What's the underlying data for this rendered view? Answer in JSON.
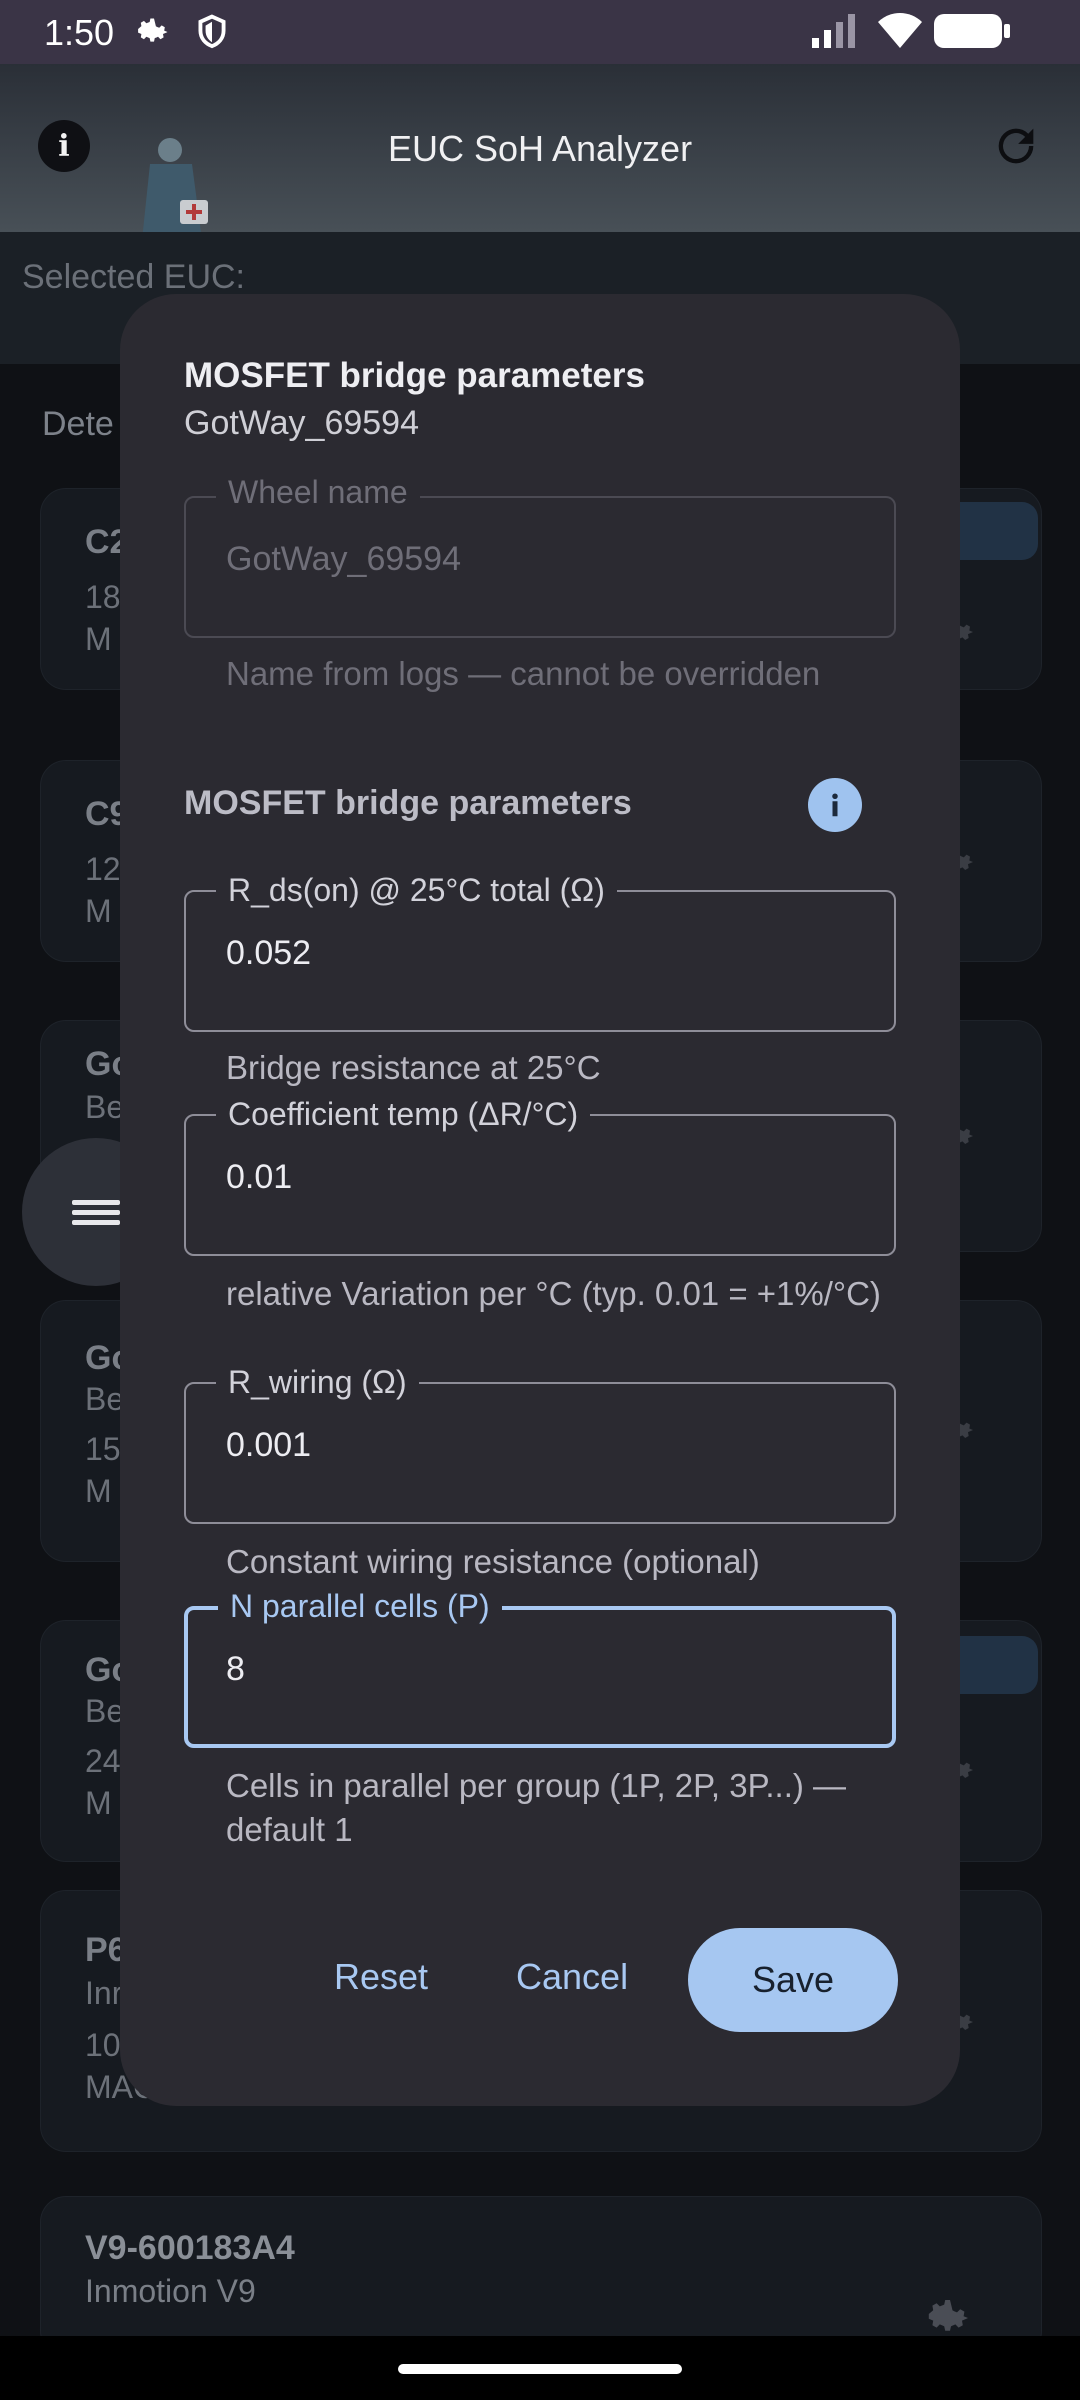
{
  "status_bar": {
    "time": "1:50"
  },
  "app_bar": {
    "title": "EUC SoH Analyzer"
  },
  "background": {
    "selected_label": "Selected EUC:",
    "detected_label": "Dete",
    "cards": [
      {
        "line1": "C2",
        "line2": "18",
        "line3": "M",
        "badge": true
      },
      {
        "line1": "C9",
        "line2": "12",
        "line3": "M",
        "badge": false
      },
      {
        "line1": "Go",
        "line2": "Be",
        "line3": "",
        "badge": false
      },
      {
        "line1": "Go",
        "line2": "Be",
        "line3": "15",
        "line4": "M",
        "badge": false
      },
      {
        "line1": "Go",
        "line2": "Be",
        "line3": "24",
        "line4": "M",
        "badge": true
      },
      {
        "line1": "P6",
        "line2": "Inr",
        "line3": "10",
        "line4": "MAC",
        "badge": false
      },
      {
        "line1": "V9-600183A4",
        "line2": "Inmotion V9",
        "badge": false
      }
    ]
  },
  "dialog": {
    "title": "MOSFET bridge parameters",
    "subtitle": "GotWay_69594",
    "wheel_name": {
      "label": "Wheel name",
      "value": "GotWay_69594",
      "helper": "Name from logs — cannot be overridden"
    },
    "section_title": "MOSFET bridge parameters",
    "fields": {
      "rds": {
        "label": "R_ds(on) @ 25°C total (Ω)",
        "value": "0.052",
        "helper": "Bridge resistance at 25°C"
      },
      "coef": {
        "label": "Coefficient temp (ΔR/°C)",
        "value": "0.01",
        "helper": "relative Variation per °C (typ. 0.01 = +1%/°C)"
      },
      "wiring": {
        "label": "R_wiring (Ω)",
        "value": "0.001",
        "helper": "Constant wiring resistance (optional)"
      },
      "parallel": {
        "label": "N parallel cells (P)",
        "value": "8",
        "helper": "Cells in parallel per group (1P, 2P, 3P...) — default 1"
      }
    },
    "buttons": {
      "reset": "Reset",
      "cancel": "Cancel",
      "save": "Save"
    }
  },
  "colors": {
    "accent": "#a8c8f2",
    "dialog_bg": "#2b2a31",
    "status_bar": "#3a3446"
  }
}
